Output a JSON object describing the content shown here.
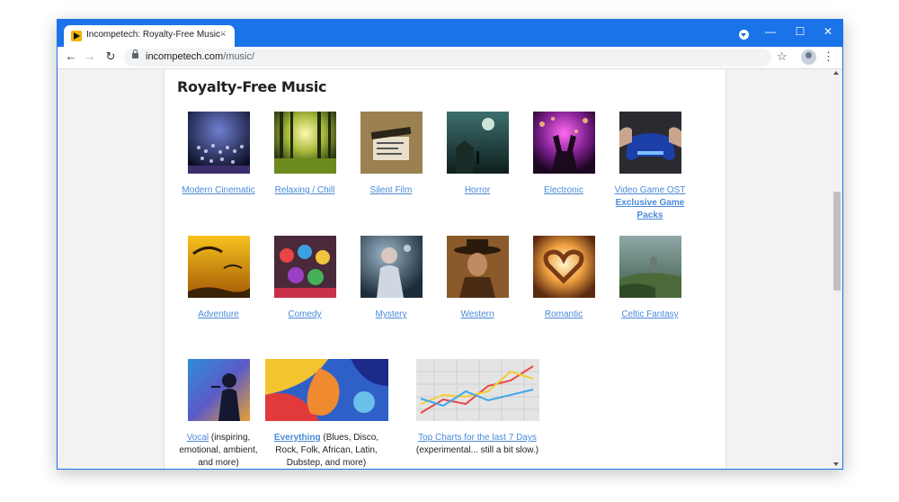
{
  "browser": {
    "tab_title": "Incompetech: Royalty-Free Music",
    "tab_close": "×",
    "new_tab": "+",
    "url_host": "incompetech.com",
    "url_path": "/music/",
    "minimize": "—",
    "maximize": "☐",
    "close": "✕",
    "back": "←",
    "forward": "→",
    "reload": "↻",
    "bookmark": "☆",
    "menu": "⋮",
    "accent_color": "#1a73e8"
  },
  "page": {
    "heading": "Royalty-Free Music",
    "link_color": "#4a8ad8"
  },
  "genres": [
    {
      "label": "Modern Cinematic",
      "icon": "orchestra-image"
    },
    {
      "label": "Relaxing / Chill",
      "icon": "forest-image"
    },
    {
      "label": "Silent Film",
      "icon": "clapperboard-image"
    },
    {
      "label": "Horror",
      "icon": "haunted-image"
    },
    {
      "label": "Electronic",
      "icon": "concert-image"
    },
    {
      "label": "Video Game OST",
      "extra_label": "Exclusive Game Packs",
      "icon": "gamepad-image"
    },
    {
      "label": "Adventure",
      "icon": "paraglider-image"
    },
    {
      "label": "Comedy",
      "icon": "clowns-image"
    },
    {
      "label": "Mystery",
      "icon": "mystery-woman-image"
    },
    {
      "label": "Western",
      "icon": "cowboy-image"
    },
    {
      "label": "Romantic",
      "icon": "heart-hands-image"
    },
    {
      "label": "Celtic Fantasy",
      "icon": "castle-image"
    },
    {
      "label": "Vocal",
      "desc": " (inspiring, emotional, ambient, and more)",
      "icon": "singer-image"
    },
    {
      "label": "Everything",
      "desc": " (Blues, Disco, Rock, Folk, African, Latin, Dubstep, and more)",
      "icon": "paint-image"
    },
    {
      "label": "Top Charts for the last 7 Days",
      "desc": "(experimental... still a bit slow.)",
      "icon": "chart-image"
    }
  ]
}
